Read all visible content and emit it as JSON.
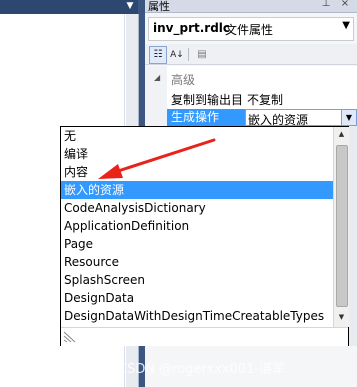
{
  "properties_window": {
    "title": "属性",
    "pin_glyph": "⊥",
    "close_glyph": "×",
    "object_name": "inv_prt.rdlc",
    "object_type": "文件属性",
    "category": "高级",
    "rows": [
      {
        "name": "复制到输出目",
        "value": "不复制"
      },
      {
        "name": "生成操作",
        "value": "嵌入的资源"
      }
    ]
  },
  "dropdown": {
    "options": [
      "无",
      "编译",
      "内容",
      "嵌入的资源",
      "CodeAnalysisDictionary",
      "ApplicationDefinition",
      "Page",
      "Resource",
      "SplashScreen",
      "DesignData",
      "DesignDataWithDesignTimeCreatableTypes"
    ],
    "selected": "嵌入的资源"
  },
  "annotation": {
    "color": "#e8231a",
    "points_to": "内容"
  },
  "watermark": "CSDN @rogerxxx001-谌军"
}
